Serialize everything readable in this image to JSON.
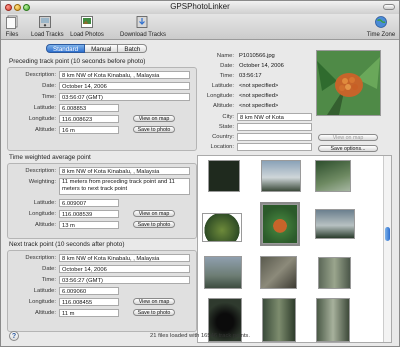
{
  "window": {
    "title": "GPSPhotoLinker"
  },
  "toolbar": {
    "items": [
      {
        "label": "Files",
        "icon": "files-icon"
      },
      {
        "label": "Load Tracks",
        "icon": "gps-icon"
      },
      {
        "label": "Load Photos",
        "icon": "photo-icon"
      },
      {
        "label": "Download Tracks",
        "icon": "download-icon"
      },
      {
        "label": "Time Zone",
        "icon": "globe-icon"
      }
    ]
  },
  "tabs": {
    "items": [
      "Standard",
      "Manual",
      "Batch"
    ],
    "selected": "Standard"
  },
  "preceding": {
    "title": "Preceding track point (10 seconds before photo)",
    "description_label": "Description:",
    "description": "8 km NW of Kota Kinabalu, , Malaysia",
    "date_label": "Date:",
    "date": "October 14, 2006",
    "time_label": "Time:",
    "time": "03:56:07 (GMT)",
    "lat_label": "Latitude:",
    "lat": "6.008853",
    "lon_label": "Longitude:",
    "lon": "116.008623",
    "alt_label": "Altitude:",
    "alt": "16 m",
    "view_btn": "View on map",
    "save_btn": "Save to photo"
  },
  "weighted": {
    "title": "Time weighted average point",
    "description_label": "Description:",
    "description": "8 km NW of Kota Kinabalu, , Malaysia",
    "weighting_label": "Weighting:",
    "weighting": "11 meters from preceding track point and 11 meters to next track point",
    "lat_label": "Latitude:",
    "lat": "6.009007",
    "lon_label": "Longitude:",
    "lon": "116.008539",
    "alt_label": "Altitude:",
    "alt": "13 m",
    "view_btn": "View on map",
    "save_btn": "Save to photo"
  },
  "next": {
    "title": "Next track point (10 seconds after photo)",
    "description_label": "Description:",
    "description": "8 km NW of Kota Kinabalu, , Malaysia",
    "date_label": "Date:",
    "date": "October 14, 2006",
    "time_label": "Time:",
    "time": "03:56:27 (GMT)",
    "lat_label": "Latitude:",
    "lat": "6.009060",
    "lon_label": "Longitude:",
    "lon": "116.008455",
    "alt_label": "Altitude:",
    "alt": "11 m",
    "view_btn": "View on map",
    "save_btn": "Save to photo"
  },
  "photo_info": {
    "name_label": "Name:",
    "name": "P1010566.jpg",
    "date_label": "Date:",
    "date": "October 14, 2006",
    "time_label": "Time:",
    "time": "03:56:17",
    "lat_label": "Latitude:",
    "lat": "<not specified>",
    "lon_label": "Longitude:",
    "lon": "<not specified>",
    "alt_label": "Altitude:",
    "alt": "<not specified>",
    "city_label": "City:",
    "city": "8 km NW of Kota",
    "state_label": "State:",
    "state": "",
    "country_label": "Country:",
    "country": "",
    "location_label": "Location:",
    "location": "",
    "view_btn": "View on map",
    "options_btn": "Save options..."
  },
  "status": {
    "text": "21 files loaded with 16546 track points."
  },
  "help": {
    "label": "?"
  },
  "colors": {
    "accent": "#2d6fcf",
    "panel": "#e0e0e0",
    "window": "#e9e9e9"
  }
}
